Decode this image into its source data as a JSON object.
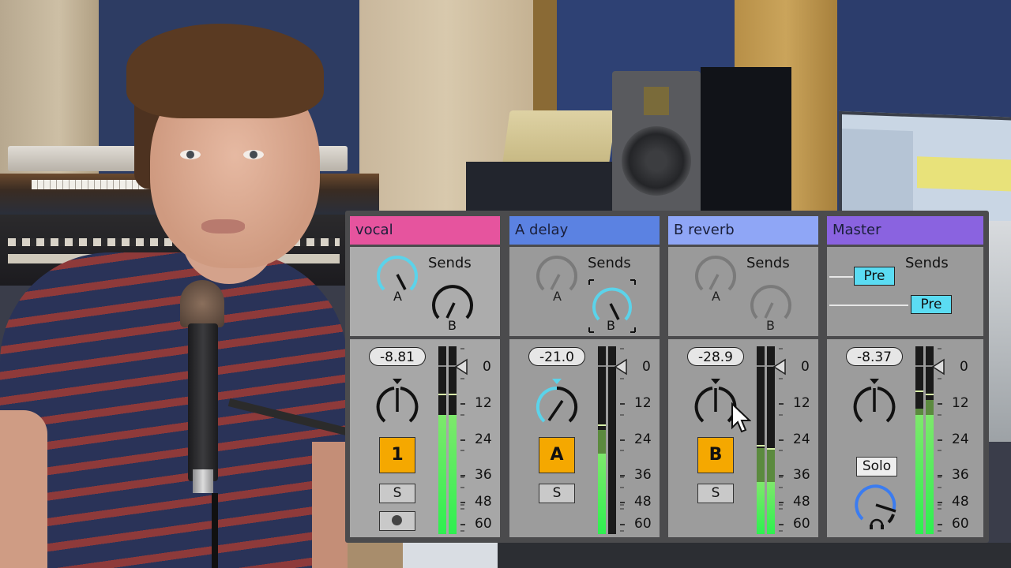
{
  "scene": {
    "description": "Presenter in recording studio with overlaid mixer panel"
  },
  "mixer": {
    "sends_label": "Sends",
    "scale_labels": [
      "0",
      "12",
      "24",
      "36",
      "48",
      "60"
    ],
    "channels": [
      {
        "name": "vocal",
        "header_color": "#e6549e",
        "volume": "-8.81",
        "track_button": "1",
        "solo_label": "S",
        "has_arm": true,
        "send_a": {
          "label": "A",
          "active": true,
          "value_fraction": 0.38
        },
        "send_b": {
          "label": "B",
          "active": false,
          "value_fraction": 0.42
        },
        "meter_left": {
          "level_db": 18,
          "hold_db": 21,
          "peak_db": 11
        },
        "meter_right": {
          "level_db": 18,
          "hold_db": 21,
          "peak_db": 11
        }
      },
      {
        "name": "A delay",
        "header_color": "#5b82e2",
        "volume": "-21.0",
        "track_button": "A",
        "solo_label": "S",
        "has_arm": false,
        "send_a": {
          "label": "A",
          "active": false,
          "value_fraction": 0.42
        },
        "send_b": {
          "label": "B",
          "active": true,
          "value_fraction": 0.35,
          "selected": true
        },
        "meter_left": {
          "level_db": 31,
          "hold_db": 23,
          "peak_db": 21
        },
        "meter_right": {
          "level_db": null,
          "hold_db": null,
          "peak_db": null
        }
      },
      {
        "name": "B reverb",
        "header_color": "#8fa6f6",
        "volume": "-28.9",
        "track_button": "B",
        "solo_label": "S",
        "has_arm": false,
        "send_a": {
          "label": "A",
          "active": false,
          "value_fraction": 0.42
        },
        "send_b": {
          "label": "B",
          "active": false,
          "value_fraction": 0.42
        },
        "meter_left": {
          "level_db": 42,
          "hold_db": 29,
          "peak_db": 28
        },
        "meter_right": {
          "level_db": 42,
          "hold_db": 29,
          "peak_db": 29
        }
      },
      {
        "name": "Master",
        "header_color": "#8a63e0",
        "volume": "-8.37",
        "solo_label": "Solo",
        "pre_labels": [
          "Pre",
          "Pre"
        ],
        "meter_left": {
          "level_db": 18,
          "hold_db": 16,
          "peak_db": 10
        },
        "meter_right": {
          "level_db": 18,
          "hold_db": 13,
          "peak_db": 11
        }
      }
    ]
  },
  "colors": {
    "active_knob": "#5bd3ea",
    "cue_knob": "#3b7cf0",
    "track_button": "#f5a800",
    "pre_button": "#5bdcf3",
    "meter_green": "#2df04f"
  }
}
